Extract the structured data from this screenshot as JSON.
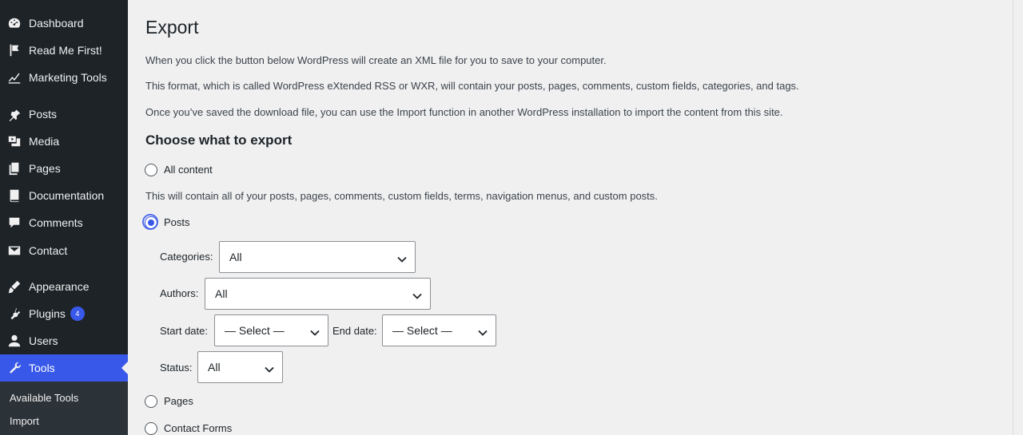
{
  "sidebar": {
    "items": [
      {
        "label": "Dashboard",
        "icon": "dashboard-icon"
      },
      {
        "label": "Read Me First!",
        "icon": "flag-icon"
      },
      {
        "label": "Marketing Tools",
        "icon": "chart-line-icon"
      },
      {
        "label": "Posts",
        "icon": "pin-icon"
      },
      {
        "label": "Media",
        "icon": "media-icon"
      },
      {
        "label": "Pages",
        "icon": "pages-icon"
      },
      {
        "label": "Documentation",
        "icon": "book-icon"
      },
      {
        "label": "Comments",
        "icon": "comment-icon"
      },
      {
        "label": "Contact",
        "icon": "mail-icon"
      },
      {
        "label": "Appearance",
        "icon": "brush-icon"
      },
      {
        "label": "Plugins",
        "icon": "plugin-icon",
        "badge": "4"
      },
      {
        "label": "Users",
        "icon": "user-icon"
      },
      {
        "label": "Tools",
        "icon": "wrench-icon",
        "active": true
      }
    ],
    "submenu": [
      "Available Tools",
      "Import"
    ],
    "accent_color": "#3858e9",
    "bg_color": "#1d2327"
  },
  "main": {
    "title": "Export",
    "intro": [
      "When you click the button below WordPress will create an XML file for you to save to your computer.",
      "This format, which is called WordPress eXtended RSS or WXR, will contain your posts, pages, comments, custom fields, categories, and tags.",
      "Once you’ve saved the download file, you can use the Import function in another WordPress installation to import the content from this site."
    ],
    "section_title": "Choose what to export",
    "options": {
      "all_content": {
        "label": "All content",
        "checked": false
      },
      "all_content_desc": "This will contain all of your posts, pages, comments, custom fields, terms, navigation menus, and custom posts.",
      "posts": {
        "label": "Posts",
        "checked": true
      },
      "pages": {
        "label": "Pages",
        "checked": false
      },
      "contact_forms": {
        "label": "Contact Forms",
        "checked": false
      }
    },
    "filters": {
      "categories": {
        "label": "Categories:",
        "value": "All"
      },
      "authors": {
        "label": "Authors:",
        "value": "All"
      },
      "start_date": {
        "label": "Start date:",
        "value": "— Select —"
      },
      "end_date": {
        "label": "End date:",
        "value": "— Select —"
      },
      "status": {
        "label": "Status:",
        "value": "All"
      }
    }
  }
}
